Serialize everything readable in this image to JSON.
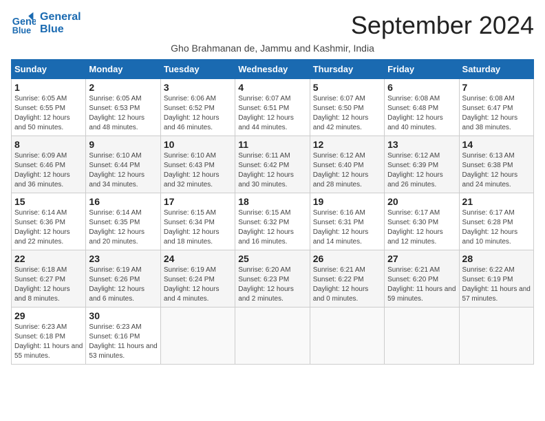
{
  "logo": {
    "line1": "General",
    "line2": "Blue"
  },
  "title": "September 2024",
  "subtitle": "Gho Brahmanan de, Jammu and Kashmir, India",
  "days_of_week": [
    "Sunday",
    "Monday",
    "Tuesday",
    "Wednesday",
    "Thursday",
    "Friday",
    "Saturday"
  ],
  "weeks": [
    [
      {
        "day": 1,
        "sunrise": "6:05 AM",
        "sunset": "6:55 PM",
        "daylight": "12 hours and 50 minutes."
      },
      {
        "day": 2,
        "sunrise": "6:05 AM",
        "sunset": "6:53 PM",
        "daylight": "12 hours and 48 minutes."
      },
      {
        "day": 3,
        "sunrise": "6:06 AM",
        "sunset": "6:52 PM",
        "daylight": "12 hours and 46 minutes."
      },
      {
        "day": 4,
        "sunrise": "6:07 AM",
        "sunset": "6:51 PM",
        "daylight": "12 hours and 44 minutes."
      },
      {
        "day": 5,
        "sunrise": "6:07 AM",
        "sunset": "6:50 PM",
        "daylight": "12 hours and 42 minutes."
      },
      {
        "day": 6,
        "sunrise": "6:08 AM",
        "sunset": "6:48 PM",
        "daylight": "12 hours and 40 minutes."
      },
      {
        "day": 7,
        "sunrise": "6:08 AM",
        "sunset": "6:47 PM",
        "daylight": "12 hours and 38 minutes."
      }
    ],
    [
      {
        "day": 8,
        "sunrise": "6:09 AM",
        "sunset": "6:46 PM",
        "daylight": "12 hours and 36 minutes."
      },
      {
        "day": 9,
        "sunrise": "6:10 AM",
        "sunset": "6:44 PM",
        "daylight": "12 hours and 34 minutes."
      },
      {
        "day": 10,
        "sunrise": "6:10 AM",
        "sunset": "6:43 PM",
        "daylight": "12 hours and 32 minutes."
      },
      {
        "day": 11,
        "sunrise": "6:11 AM",
        "sunset": "6:42 PM",
        "daylight": "12 hours and 30 minutes."
      },
      {
        "day": 12,
        "sunrise": "6:12 AM",
        "sunset": "6:40 PM",
        "daylight": "12 hours and 28 minutes."
      },
      {
        "day": 13,
        "sunrise": "6:12 AM",
        "sunset": "6:39 PM",
        "daylight": "12 hours and 26 minutes."
      },
      {
        "day": 14,
        "sunrise": "6:13 AM",
        "sunset": "6:38 PM",
        "daylight": "12 hours and 24 minutes."
      }
    ],
    [
      {
        "day": 15,
        "sunrise": "6:14 AM",
        "sunset": "6:36 PM",
        "daylight": "12 hours and 22 minutes."
      },
      {
        "day": 16,
        "sunrise": "6:14 AM",
        "sunset": "6:35 PM",
        "daylight": "12 hours and 20 minutes."
      },
      {
        "day": 17,
        "sunrise": "6:15 AM",
        "sunset": "6:34 PM",
        "daylight": "12 hours and 18 minutes."
      },
      {
        "day": 18,
        "sunrise": "6:15 AM",
        "sunset": "6:32 PM",
        "daylight": "12 hours and 16 minutes."
      },
      {
        "day": 19,
        "sunrise": "6:16 AM",
        "sunset": "6:31 PM",
        "daylight": "12 hours and 14 minutes."
      },
      {
        "day": 20,
        "sunrise": "6:17 AM",
        "sunset": "6:30 PM",
        "daylight": "12 hours and 12 minutes."
      },
      {
        "day": 21,
        "sunrise": "6:17 AM",
        "sunset": "6:28 PM",
        "daylight": "12 hours and 10 minutes."
      }
    ],
    [
      {
        "day": 22,
        "sunrise": "6:18 AM",
        "sunset": "6:27 PM",
        "daylight": "12 hours and 8 minutes."
      },
      {
        "day": 23,
        "sunrise": "6:19 AM",
        "sunset": "6:26 PM",
        "daylight": "12 hours and 6 minutes."
      },
      {
        "day": 24,
        "sunrise": "6:19 AM",
        "sunset": "6:24 PM",
        "daylight": "12 hours and 4 minutes."
      },
      {
        "day": 25,
        "sunrise": "6:20 AM",
        "sunset": "6:23 PM",
        "daylight": "12 hours and 2 minutes."
      },
      {
        "day": 26,
        "sunrise": "6:21 AM",
        "sunset": "6:22 PM",
        "daylight": "12 hours and 0 minutes."
      },
      {
        "day": 27,
        "sunrise": "6:21 AM",
        "sunset": "6:20 PM",
        "daylight": "11 hours and 59 minutes."
      },
      {
        "day": 28,
        "sunrise": "6:22 AM",
        "sunset": "6:19 PM",
        "daylight": "11 hours and 57 minutes."
      }
    ],
    [
      {
        "day": 29,
        "sunrise": "6:23 AM",
        "sunset": "6:18 PM",
        "daylight": "11 hours and 55 minutes."
      },
      {
        "day": 30,
        "sunrise": "6:23 AM",
        "sunset": "6:16 PM",
        "daylight": "11 hours and 53 minutes."
      },
      null,
      null,
      null,
      null,
      null
    ]
  ]
}
